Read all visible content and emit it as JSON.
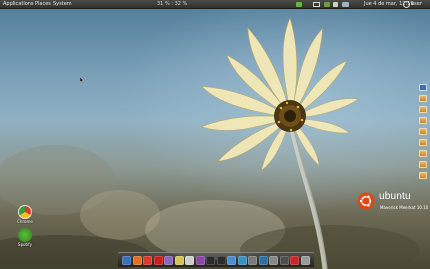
{
  "top_panel": {
    "menus": [
      "Applications",
      "Places",
      "System"
    ],
    "cpu": "31 % : 32 %",
    "clock": "Jue 4 de mar, 12:19",
    "user": "user"
  },
  "desktop_icons": [
    {
      "label": "Chrome",
      "icon": "chrome-icon"
    },
    {
      "label": "Spotify",
      "icon": "spotify-icon"
    }
  ],
  "sidebar": {
    "items": [
      "computer-icon",
      "folder-icon",
      "folder-icon",
      "folder-icon",
      "folder-icon",
      "folder-icon",
      "folder-icon",
      "folder-icon",
      "folder-icon"
    ]
  },
  "branding": {
    "wordmark": "ubuntu",
    "version": "Maverick Meerkat 10.10",
    "accent": "#dd4814"
  },
  "dock": {
    "items": [
      {
        "name": "finder-icon",
        "color": "#3b6fb6"
      },
      {
        "name": "firefox-icon",
        "color": "#e07020"
      },
      {
        "name": "chrome-icon",
        "color": "#d93a2c"
      },
      {
        "name": "opera-icon",
        "color": "#c81f1f"
      },
      {
        "name": "pidgin-icon",
        "color": "#8a68b8"
      },
      {
        "name": "notes-icon",
        "color": "#d6c45a"
      },
      {
        "name": "calendar-icon",
        "color": "#cfcfcf"
      },
      {
        "name": "purple-app-icon",
        "color": "#8b48a8"
      },
      {
        "name": "media-icon",
        "color": "#2b2b2b"
      },
      {
        "name": "terminal-icon",
        "color": "#2c2c2c"
      },
      {
        "name": "network-icon",
        "color": "#4a8fcf"
      },
      {
        "name": "photos-icon",
        "color": "#3d8fc0"
      },
      {
        "name": "settings-icon",
        "color": "#7a7a7a"
      },
      {
        "name": "music-icon",
        "color": "#2f6fa8"
      },
      {
        "name": "disk-icon",
        "color": "#888888"
      },
      {
        "name": "monitor-icon",
        "color": "#4e4e4e"
      },
      {
        "name": "mail-icon",
        "color": "#c02a2a"
      },
      {
        "name": "trash-icon",
        "color": "#9a9a9a"
      }
    ]
  }
}
